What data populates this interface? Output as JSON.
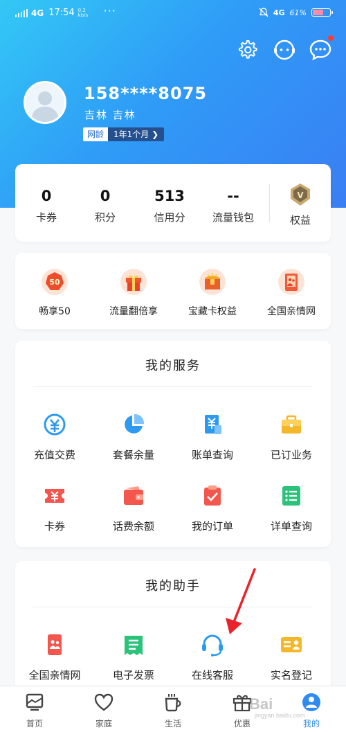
{
  "status_bar": {
    "network": "4G",
    "time": "17:54",
    "speed": "0.2 kb/s",
    "more": "···",
    "network_right": "4G",
    "battery_text": "61%"
  },
  "header": {
    "icons": [
      "gear-icon",
      "service-face-icon",
      "message-icon"
    ]
  },
  "profile": {
    "phone": "158****8075",
    "location": "吉林 吉林",
    "tenure_label": "网龄",
    "tenure_value": "1年1个月"
  },
  "stats": {
    "items": [
      {
        "value": "0",
        "label": "卡券"
      },
      {
        "value": "0",
        "label": "积分"
      },
      {
        "value": "513",
        "label": "信用分"
      },
      {
        "value": "--",
        "label": "流量钱包"
      }
    ],
    "benefit_label": "权益"
  },
  "promos": [
    {
      "label": "畅享50",
      "icon": "badge-50-icon"
    },
    {
      "label": "流量翻倍享",
      "icon": "gift-box-icon"
    },
    {
      "label": "宝藏卡权益",
      "icon": "treasure-chest-icon"
    },
    {
      "label": "全国亲情网",
      "icon": "family-frame-icon"
    }
  ],
  "services": {
    "title": "我的服务",
    "items": [
      {
        "label": "充值交费",
        "icon": "recharge-icon",
        "color": "#2d9af0"
      },
      {
        "label": "套餐余量",
        "icon": "pie-chart-icon",
        "color": "#2d9af0"
      },
      {
        "label": "账单查询",
        "icon": "bill-icon",
        "color": "#2d9af0"
      },
      {
        "label": "已订业务",
        "icon": "briefcase-icon",
        "color": "#f5b72a"
      },
      {
        "label": "卡券",
        "icon": "coupon-icon",
        "color": "#f2564d"
      },
      {
        "label": "话费余额",
        "icon": "wallet-icon",
        "color": "#f2564d"
      },
      {
        "label": "我的订单",
        "icon": "order-icon",
        "color": "#f2564d"
      },
      {
        "label": "详单查询",
        "icon": "list-icon",
        "color": "#2bc27a"
      }
    ]
  },
  "assistant": {
    "title": "我的助手",
    "items": [
      {
        "label": "全国亲情网",
        "icon": "family-phone-icon",
        "color": "#f2564d"
      },
      {
        "label": "电子发票",
        "icon": "invoice-icon",
        "color": "#2bc27a"
      },
      {
        "label": "在线客服",
        "icon": "headset-icon",
        "color": "#2d9af0"
      },
      {
        "label": "实名登记",
        "icon": "id-card-icon",
        "color": "#f5b72a"
      }
    ]
  },
  "bottom_nav": {
    "items": [
      {
        "label": "首页",
        "icon": "home-icon"
      },
      {
        "label": "家庭",
        "icon": "heart-icon"
      },
      {
        "label": "生活",
        "icon": "cup-icon"
      },
      {
        "label": "优惠",
        "icon": "gift-icon"
      },
      {
        "label": "我的",
        "icon": "user-icon"
      }
    ],
    "active_index": 4
  },
  "watermark": {
    "text": "Bai",
    "sub": "jingyan.baidu.com"
  },
  "colors": {
    "hero_start": "#33c8f5",
    "hero_end": "#3a7ef4",
    "accent": "#2e8bf0",
    "arrow": "#e8232b"
  }
}
